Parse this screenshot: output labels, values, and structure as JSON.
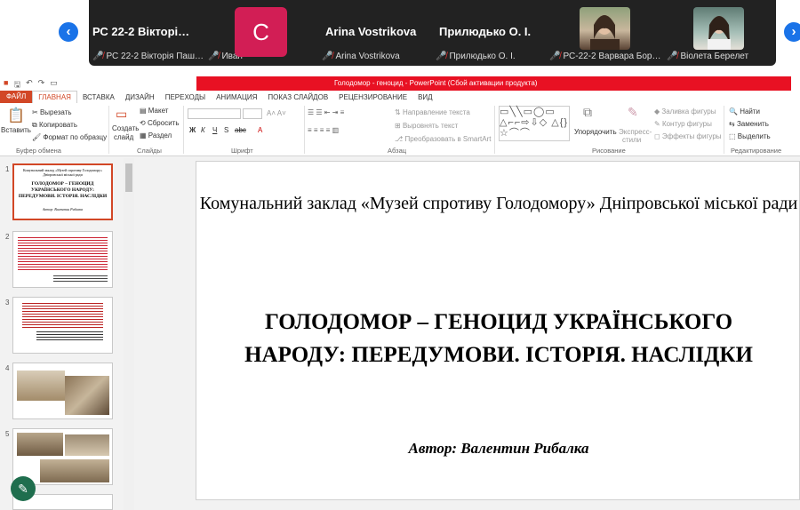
{
  "meeting": {
    "nav_prev": "‹",
    "nav_next": "›",
    "tiles": [
      {
        "name": "РС 22-2 Вікторі…",
        "caption": "РС 22-2 Вікторія Паш…"
      },
      {
        "name": "",
        "caption": "Иван",
        "avatar_letter": "C"
      },
      {
        "name": "Arina Vostrikova",
        "caption": "Arina Vostrikova"
      },
      {
        "name": "Прилюдько О. І.",
        "caption": "Прилюдько О. І."
      },
      {
        "name": "",
        "caption": "РС-22-2 Варвара Бор…"
      },
      {
        "name": "",
        "caption": "Віолета Берелет"
      }
    ]
  },
  "window": {
    "title": "Голодомор - геноцид  -  PowerPoint (Сбой активации продукта)"
  },
  "tabs": [
    "ФАЙЛ",
    "ГЛАВНАЯ",
    "ВСТАВКА",
    "ДИЗАЙН",
    "ПЕРЕХОДЫ",
    "АНИМАЦИЯ",
    "ПОКАЗ СЛАЙДОВ",
    "РЕЦЕНЗИРОВАНИЕ",
    "ВИД"
  ],
  "ribbon": {
    "paste": "Вставить",
    "cut": "Вырезать",
    "copy": "Копировать",
    "format_painter": "Формат по образцу",
    "clipboard_group": "Буфер обмена",
    "new_slide": "Создать",
    "new_slide_2": "слайд",
    "layout": "Макет",
    "reset": "Сбросить",
    "section": "Раздел",
    "slides_group": "Слайды",
    "bold": "Ж",
    "italic": "К",
    "underline": "Ч",
    "strike": "S",
    "shadow": "abc",
    "font_group": "Шрифт",
    "text_direction": "Направление текста",
    "align_text": "Выровнять текст",
    "smartart": "Преобразовать в SmartArt",
    "paragraph_group": "Абзац",
    "arrange": "Упорядочить",
    "quick_styles": "Экспресс-",
    "quick_styles_2": "стили",
    "shape_fill": "Заливка фигуры",
    "shape_outline": "Контур фигуры",
    "shape_effects": "Эффекты фигуры",
    "drawing_group": "Рисование",
    "find": "Найти",
    "replace": "Заменить",
    "select": "Выделить",
    "editing_group": "Редактирование"
  },
  "thumbnails": [
    {
      "num": "1",
      "line1": "Комунальний заклад «Музей спротиву Голодомору» Дніпровської міської ради",
      "line2": "ГОЛОДОМОР – ГЕНОЦИД УКРАЇНСЬКОГО НАРОДУ: ПЕРЕДУМОВИ. ІСТОРІЯ. НАСЛІДКИ",
      "line3": "Автор: Валентин Рибалка"
    },
    {
      "num": "2"
    },
    {
      "num": "3"
    },
    {
      "num": "4"
    },
    {
      "num": "5"
    }
  ],
  "slide": {
    "institution": "Комунальний заклад «Музей спротиву Голодомору» Дніпровської міської ради",
    "title": "ГОЛОДОМОР – ГЕНОЦИД УКРАЇНСЬКОГО НАРОДУ: ПЕРЕДУМОВИ. ІСТОРІЯ. НАСЛІДКИ",
    "author": "Автор: Валентин Рибалка"
  },
  "fab_icon": "✎",
  "colors": {
    "accent": "#d24726",
    "title_bar": "#e81123",
    "zoom_blue": "#1a73e8",
    "avatar": "#d21e55"
  }
}
